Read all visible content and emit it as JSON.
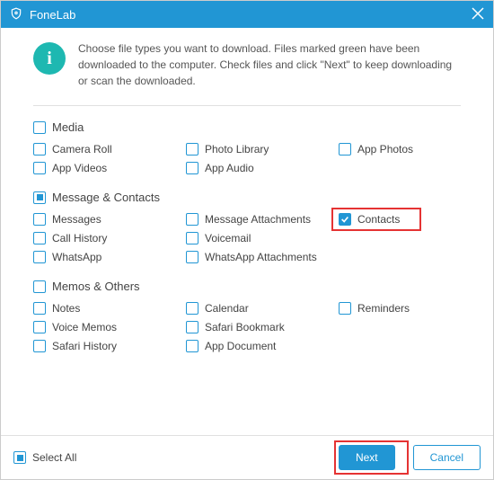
{
  "titlebar": {
    "title": "FoneLab"
  },
  "intro": {
    "text": "Choose file types you want to download. Files marked green have been downloaded to the computer. Check files and click \"Next\" to keep downloading or scan the downloaded."
  },
  "sections": {
    "media": {
      "label": "Media",
      "items": {
        "camera_roll": "Camera Roll",
        "photo_library": "Photo Library",
        "app_photos": "App Photos",
        "app_videos": "App Videos",
        "app_audio": "App Audio"
      }
    },
    "message_contacts": {
      "label": "Message & Contacts",
      "items": {
        "messages": "Messages",
        "message_attachments": "Message Attachments",
        "contacts": "Contacts",
        "call_history": "Call History",
        "voicemail": "Voicemail",
        "whatsapp": "WhatsApp",
        "whatsapp_attachments": "WhatsApp Attachments"
      }
    },
    "memos_others": {
      "label": "Memos & Others",
      "items": {
        "notes": "Notes",
        "calendar": "Calendar",
        "reminders": "Reminders",
        "voice_memos": "Voice Memos",
        "safari_bookmark": "Safari Bookmark",
        "safari_history": "Safari History",
        "app_document": "App Document"
      }
    }
  },
  "footer": {
    "select_all": "Select All",
    "next": "Next",
    "cancel": "Cancel"
  },
  "state": {
    "media": "unchecked",
    "message_contacts": "indeterminate",
    "memos_others": "unchecked",
    "contacts": "checked",
    "select_all": "indeterminate"
  },
  "colors": {
    "primary": "#2196d4",
    "accent": "#1eb8b1",
    "highlight": "#e53333"
  }
}
